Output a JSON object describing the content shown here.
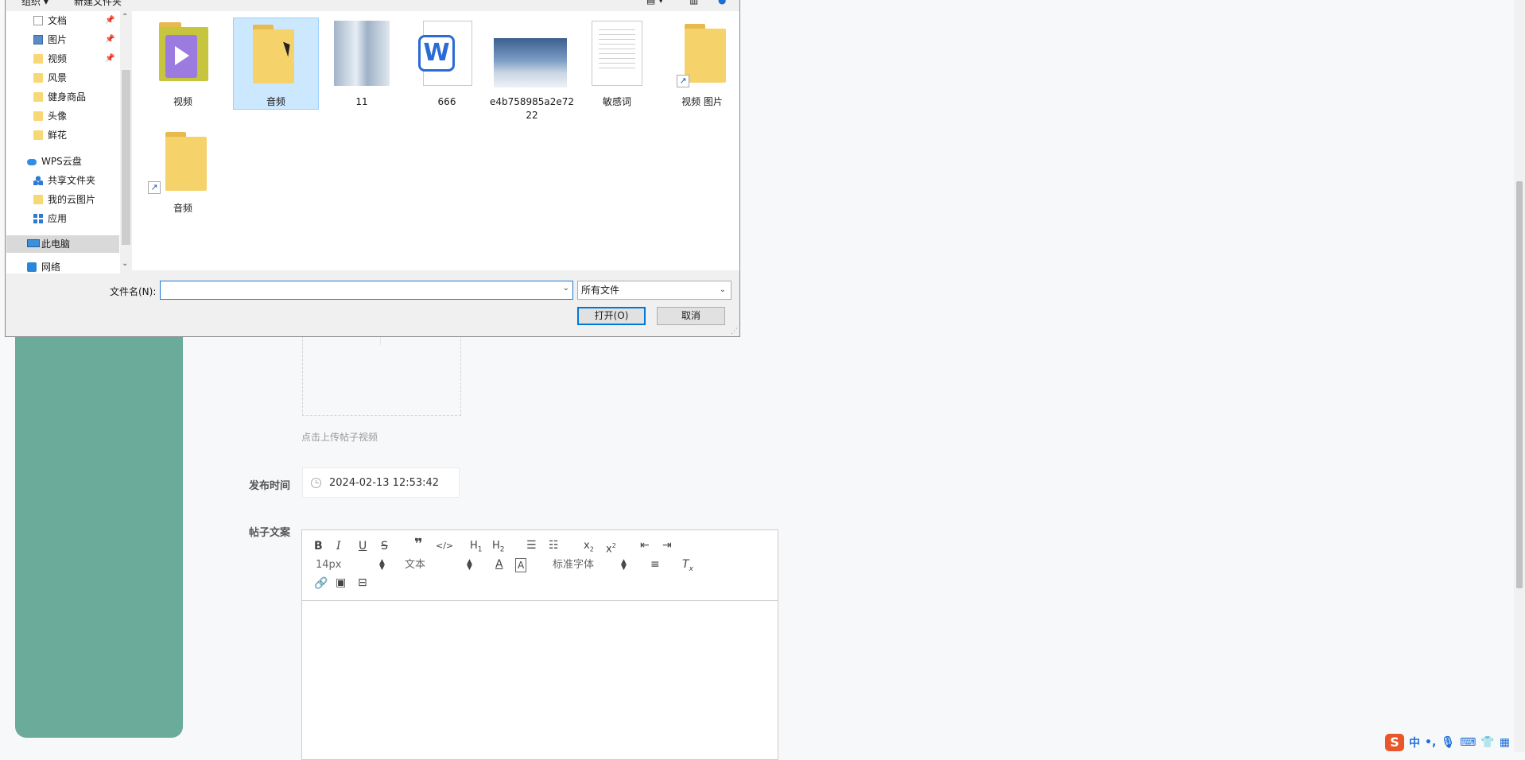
{
  "dialog": {
    "top_bar": {
      "organize": "组织 ▾",
      "new_folder": "新建文件夹"
    },
    "nav_items": [
      {
        "label": "文档",
        "icon": "document-icon",
        "pinned": true
      },
      {
        "label": "图片",
        "icon": "pictures-icon",
        "pinned": true
      },
      {
        "label": "视频",
        "icon": "folder-icon",
        "pinned": true
      },
      {
        "label": "风景",
        "icon": "folder-icon"
      },
      {
        "label": "健身商品",
        "icon": "folder-icon"
      },
      {
        "label": "头像",
        "icon": "folder-icon"
      },
      {
        "label": "鲜花",
        "icon": "folder-icon"
      },
      {
        "label": "WPS云盘",
        "icon": "cloud-icon"
      },
      {
        "label": "共享文件夹",
        "icon": "share-icon"
      },
      {
        "label": "我的云图片",
        "icon": "folder-icon"
      },
      {
        "label": "应用",
        "icon": "apps-icon"
      },
      {
        "label": "此电脑",
        "icon": "computer-icon",
        "selected": true
      },
      {
        "label": "网络",
        "icon": "network-icon"
      }
    ],
    "files": [
      {
        "name": "视频",
        "type": "media-folder"
      },
      {
        "name": "音频",
        "type": "folder",
        "selected": true
      },
      {
        "name": "11",
        "type": "image"
      },
      {
        "name": "666",
        "type": "word-document"
      },
      {
        "name": "e4b758985a2e7222",
        "type": "image"
      },
      {
        "name": "敏感词",
        "type": "text-document"
      },
      {
        "name": "视频 图片",
        "type": "folder-shortcut"
      },
      {
        "name": "音频",
        "type": "folder-shortcut"
      }
    ],
    "filename_label": "文件名(N):",
    "filename_value": "",
    "filetype_value": "所有文件",
    "open_button": "打开(O)",
    "cancel_button": "取消"
  },
  "page": {
    "upload_hint": "点击上传帖子视频",
    "publish_time_label": "发布时间",
    "publish_time_value": "2024-02-13 12:53:42",
    "post_text_label": "帖子文案",
    "editor_toolbar": {
      "font_size": "14px",
      "block_type": "文本",
      "font_family": "标准字体"
    }
  },
  "ime": {
    "lang": "中",
    "punct": "•,",
    "logo": "S"
  },
  "colors": {
    "side_panel": "#6aab9a",
    "dialog_selection": "#cce8ff",
    "primary_border": "#0078d7"
  }
}
